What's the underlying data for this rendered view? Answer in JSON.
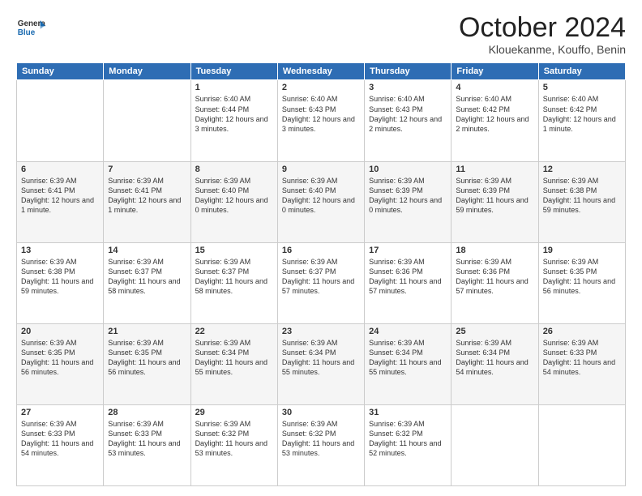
{
  "header": {
    "logo_general": "General",
    "logo_blue": "Blue",
    "title": "October 2024",
    "location": "Klouekanme, Kouffo, Benin"
  },
  "days_of_week": [
    "Sunday",
    "Monday",
    "Tuesday",
    "Wednesday",
    "Thursday",
    "Friday",
    "Saturday"
  ],
  "weeks": [
    [
      {
        "day": "",
        "text": ""
      },
      {
        "day": "",
        "text": ""
      },
      {
        "day": "1",
        "text": "Sunrise: 6:40 AM\nSunset: 6:44 PM\nDaylight: 12 hours and 3 minutes."
      },
      {
        "day": "2",
        "text": "Sunrise: 6:40 AM\nSunset: 6:43 PM\nDaylight: 12 hours and 3 minutes."
      },
      {
        "day": "3",
        "text": "Sunrise: 6:40 AM\nSunset: 6:43 PM\nDaylight: 12 hours and 2 minutes."
      },
      {
        "day": "4",
        "text": "Sunrise: 6:40 AM\nSunset: 6:42 PM\nDaylight: 12 hours and 2 minutes."
      },
      {
        "day": "5",
        "text": "Sunrise: 6:40 AM\nSunset: 6:42 PM\nDaylight: 12 hours and 1 minute."
      }
    ],
    [
      {
        "day": "6",
        "text": "Sunrise: 6:39 AM\nSunset: 6:41 PM\nDaylight: 12 hours and 1 minute."
      },
      {
        "day": "7",
        "text": "Sunrise: 6:39 AM\nSunset: 6:41 PM\nDaylight: 12 hours and 1 minute."
      },
      {
        "day": "8",
        "text": "Sunrise: 6:39 AM\nSunset: 6:40 PM\nDaylight: 12 hours and 0 minutes."
      },
      {
        "day": "9",
        "text": "Sunrise: 6:39 AM\nSunset: 6:40 PM\nDaylight: 12 hours and 0 minutes."
      },
      {
        "day": "10",
        "text": "Sunrise: 6:39 AM\nSunset: 6:39 PM\nDaylight: 12 hours and 0 minutes."
      },
      {
        "day": "11",
        "text": "Sunrise: 6:39 AM\nSunset: 6:39 PM\nDaylight: 11 hours and 59 minutes."
      },
      {
        "day": "12",
        "text": "Sunrise: 6:39 AM\nSunset: 6:38 PM\nDaylight: 11 hours and 59 minutes."
      }
    ],
    [
      {
        "day": "13",
        "text": "Sunrise: 6:39 AM\nSunset: 6:38 PM\nDaylight: 11 hours and 59 minutes."
      },
      {
        "day": "14",
        "text": "Sunrise: 6:39 AM\nSunset: 6:37 PM\nDaylight: 11 hours and 58 minutes."
      },
      {
        "day": "15",
        "text": "Sunrise: 6:39 AM\nSunset: 6:37 PM\nDaylight: 11 hours and 58 minutes."
      },
      {
        "day": "16",
        "text": "Sunrise: 6:39 AM\nSunset: 6:37 PM\nDaylight: 11 hours and 57 minutes."
      },
      {
        "day": "17",
        "text": "Sunrise: 6:39 AM\nSunset: 6:36 PM\nDaylight: 11 hours and 57 minutes."
      },
      {
        "day": "18",
        "text": "Sunrise: 6:39 AM\nSunset: 6:36 PM\nDaylight: 11 hours and 57 minutes."
      },
      {
        "day": "19",
        "text": "Sunrise: 6:39 AM\nSunset: 6:35 PM\nDaylight: 11 hours and 56 minutes."
      }
    ],
    [
      {
        "day": "20",
        "text": "Sunrise: 6:39 AM\nSunset: 6:35 PM\nDaylight: 11 hours and 56 minutes."
      },
      {
        "day": "21",
        "text": "Sunrise: 6:39 AM\nSunset: 6:35 PM\nDaylight: 11 hours and 56 minutes."
      },
      {
        "day": "22",
        "text": "Sunrise: 6:39 AM\nSunset: 6:34 PM\nDaylight: 11 hours and 55 minutes."
      },
      {
        "day": "23",
        "text": "Sunrise: 6:39 AM\nSunset: 6:34 PM\nDaylight: 11 hours and 55 minutes."
      },
      {
        "day": "24",
        "text": "Sunrise: 6:39 AM\nSunset: 6:34 PM\nDaylight: 11 hours and 55 minutes."
      },
      {
        "day": "25",
        "text": "Sunrise: 6:39 AM\nSunset: 6:34 PM\nDaylight: 11 hours and 54 minutes."
      },
      {
        "day": "26",
        "text": "Sunrise: 6:39 AM\nSunset: 6:33 PM\nDaylight: 11 hours and 54 minutes."
      }
    ],
    [
      {
        "day": "27",
        "text": "Sunrise: 6:39 AM\nSunset: 6:33 PM\nDaylight: 11 hours and 54 minutes."
      },
      {
        "day": "28",
        "text": "Sunrise: 6:39 AM\nSunset: 6:33 PM\nDaylight: 11 hours and 53 minutes."
      },
      {
        "day": "29",
        "text": "Sunrise: 6:39 AM\nSunset: 6:32 PM\nDaylight: 11 hours and 53 minutes."
      },
      {
        "day": "30",
        "text": "Sunrise: 6:39 AM\nSunset: 6:32 PM\nDaylight: 11 hours and 53 minutes."
      },
      {
        "day": "31",
        "text": "Sunrise: 6:39 AM\nSunset: 6:32 PM\nDaylight: 11 hours and 52 minutes."
      },
      {
        "day": "",
        "text": ""
      },
      {
        "day": "",
        "text": ""
      }
    ]
  ]
}
